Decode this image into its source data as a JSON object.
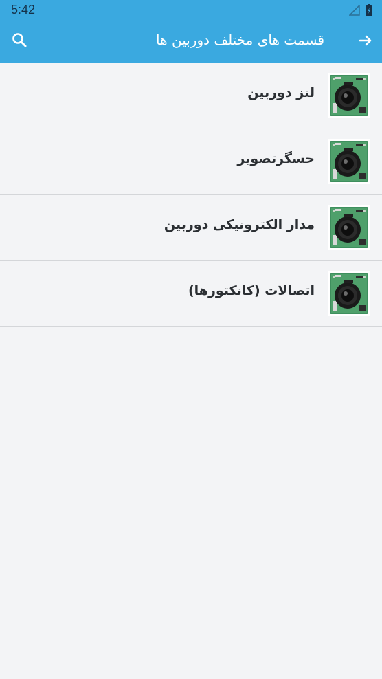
{
  "status_bar": {
    "time": "5:42",
    "icons": [
      "signal-icon",
      "battery-icon"
    ]
  },
  "app_bar": {
    "title": "قسمت های مختلف دوربین ها",
    "back_icon": "arrow-right-icon",
    "search_icon": "search-icon",
    "color": "#3aa9e0"
  },
  "list": {
    "items": [
      {
        "label": "لنز دوربین",
        "icon": "camera-module-thumbnail"
      },
      {
        "label": "حسگرتصویر",
        "icon": "camera-module-thumbnail"
      },
      {
        "label": "مدار الکترونیکی دوربین",
        "icon": "camera-module-thumbnail"
      },
      {
        "label": "اتصالات (کانکتورها)",
        "icon": "camera-module-thumbnail"
      }
    ]
  }
}
